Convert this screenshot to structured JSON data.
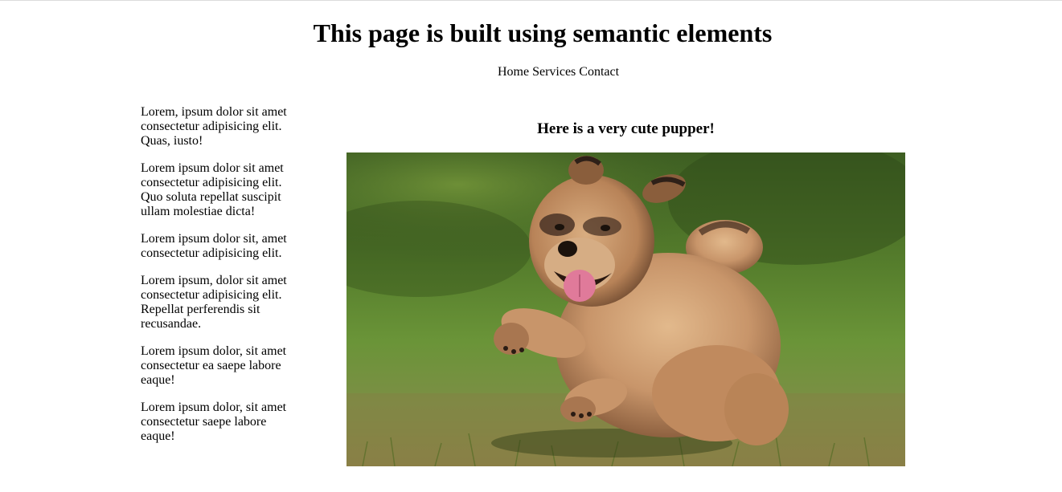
{
  "header": {
    "title": "This page is built using semantic elements"
  },
  "nav": {
    "items": [
      {
        "label": "Home"
      },
      {
        "label": "Services"
      },
      {
        "label": "Contact"
      }
    ]
  },
  "aside": {
    "paragraphs": [
      "Lorem, ipsum dolor sit amet consectetur adipisicing elit. Quas, iusto!",
      "Lorem ipsum dolor sit amet consectetur adipisicing elit. Quo soluta repellat suscipit ullam molestiae dicta!",
      "Lorem ipsum dolor sit, amet consectetur adipisicing elit.",
      "Lorem ipsum, dolor sit amet consectetur adipisicing elit. Repellat perferendis sit recusandae.",
      "Lorem ipsum dolor, sit amet consectetur ea saepe labore eaque!",
      "Lorem ipsum dolor, sit amet consectetur saepe labore eaque!"
    ]
  },
  "main": {
    "heading": "Here is a very cute pupper!",
    "image_icon": "puppy-photo"
  },
  "colors": {
    "grass": "#5e8a34",
    "grass_dark": "#3f6a22",
    "puppy_fur": "#c8956a",
    "puppy_dark": "#4a3326",
    "tongue": "#e07a9a"
  }
}
